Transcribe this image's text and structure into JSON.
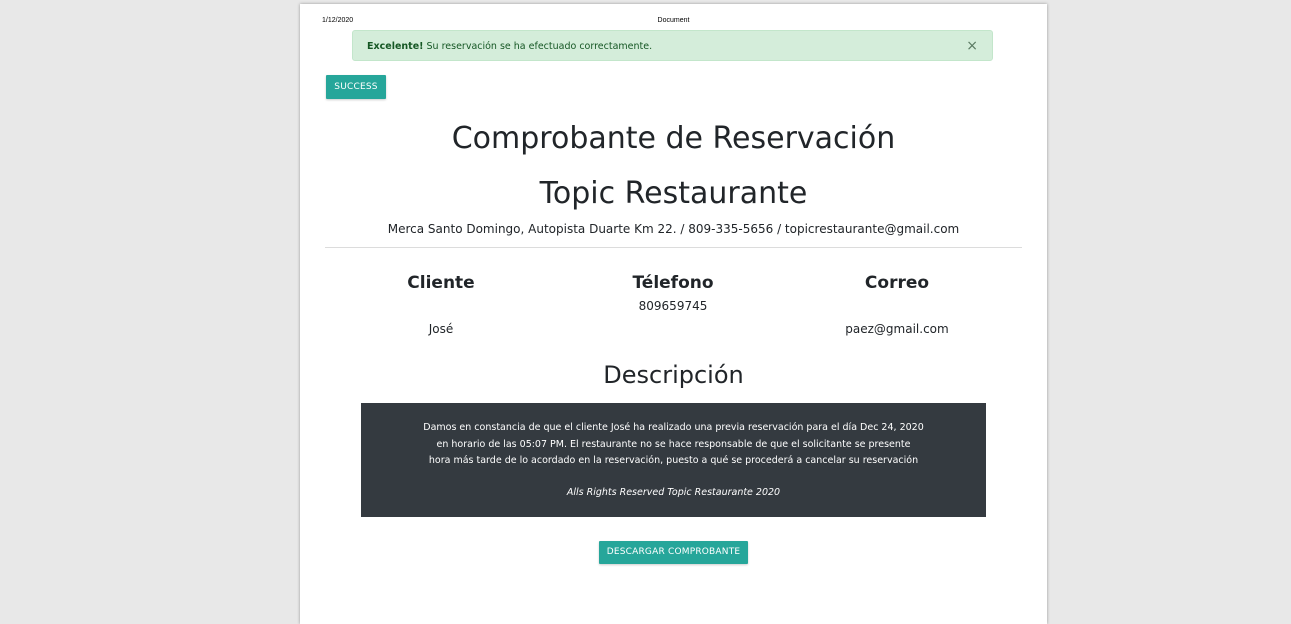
{
  "print_header": {
    "date": "1/12/2020",
    "title": "Document"
  },
  "alert": {
    "strong": "Excelente!",
    "message": " Su reservación se ha efectuado correctamente.",
    "close": "×"
  },
  "success_button": "SUCCESS",
  "receipt": {
    "title": "Comprobante de Reservación",
    "restaurant": "Topic Restaurante",
    "address": "Merca Santo Domingo, Autopista Duarte Km 22. / 809-335-5656 / topicrestaurante@gmail.com"
  },
  "columns": {
    "cliente": {
      "label": "Cliente",
      "value": "José"
    },
    "telefono": {
      "label": "Télefono",
      "value": "809659745"
    },
    "correo": {
      "label": "Correo",
      "value": "paez@gmail.com"
    }
  },
  "description": {
    "title": "Descripción",
    "line1": "Damos en constancia de que el cliente José ha realizado una previa reservación para el día Dec 24, 2020",
    "line2": "en horario de las 05:07 PM. El restaurante no se hace responsable de que el solicitante se presente",
    "line3": "hora más tarde de lo acordado en la reservación, puesto a qué se procederá a cancelar su reservación",
    "rights": "Alls Rights Reserved Topic Restaurante 2020"
  },
  "download_button": "DESCARGAR COMPROBANTE",
  "colors": {
    "accent": "#26a69a",
    "alert_bg": "#d4edda",
    "alert_text": "#155724",
    "dark_box": "#343a40"
  }
}
